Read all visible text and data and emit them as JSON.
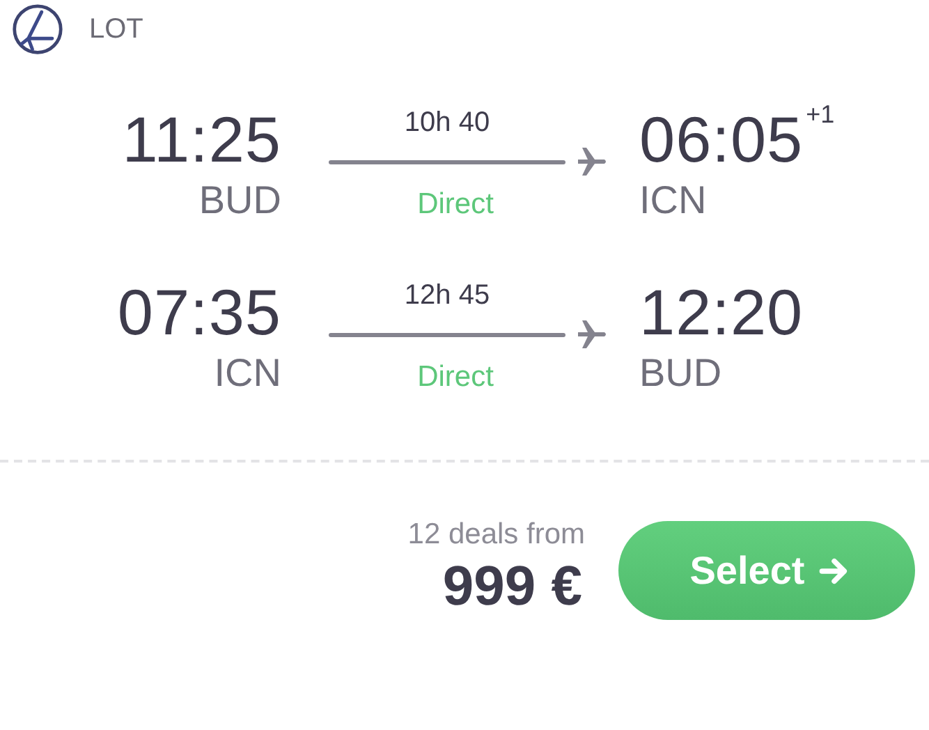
{
  "airline": {
    "name": "LOT"
  },
  "legs": [
    {
      "departure_time": "11:25",
      "departure_airport": "BUD",
      "duration": "10h 40",
      "stops": "Direct",
      "arrival_time": "06:05",
      "day_offset": "+1",
      "arrival_airport": "ICN"
    },
    {
      "departure_time": "07:35",
      "departure_airport": "ICN",
      "duration": "12h 45",
      "stops": "Direct",
      "arrival_time": "12:20",
      "arrival_airport": "BUD"
    }
  ],
  "price": {
    "caption": "12 deals from",
    "amount": "999 €"
  },
  "select_button": {
    "label": "Select"
  }
}
